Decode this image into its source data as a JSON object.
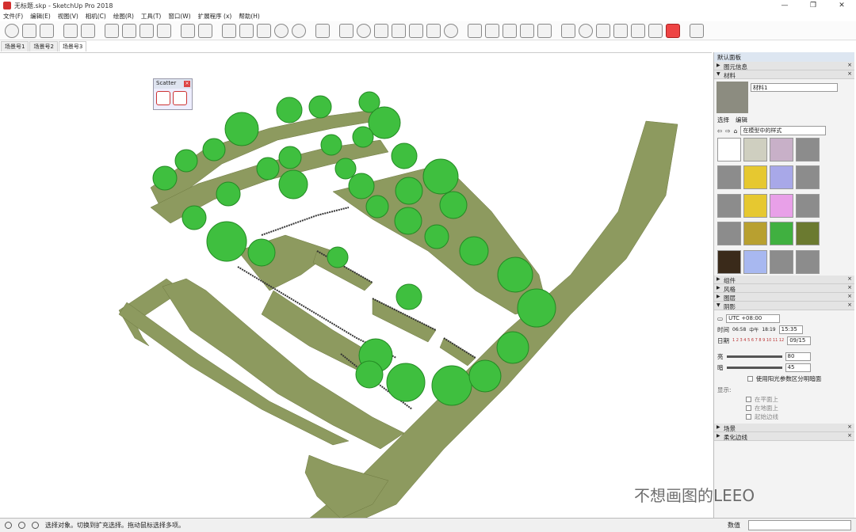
{
  "titlebar": {
    "title": "无标题.skp - SketchUp Pro 2018",
    "minimize": "—",
    "maximize": "❐",
    "close": "✕"
  },
  "menu": [
    "文件(F)",
    "编辑(E)",
    "视图(V)",
    "相机(C)",
    "绘图(R)",
    "工具(T)",
    "窗口(W)",
    "扩展程序 (x)",
    "帮助(H)"
  ],
  "scene_tabs": [
    "场景号1",
    "场景号2",
    "场景号3"
  ],
  "scatter": {
    "title": "Scatter"
  },
  "tray": {
    "title": "默认面板",
    "entity_info": "图元信息",
    "materials": "材料",
    "material_name": "材料1",
    "tab_select": "选择",
    "tab_edit": "编辑",
    "library": "在模型中的样式",
    "components": "组件",
    "styles": "风格",
    "layers": "图层",
    "shadows": "阴影",
    "timezone": "UTC +08:00",
    "time_label": "时间",
    "time_start": "06:58",
    "time_mid": "中午",
    "time_end": "18:19",
    "time_value": "15:35",
    "date_label": "日期",
    "months": "1 2 3 4 5 6 7 8 9 10 11 12",
    "date_value": "09/15",
    "light_label": "亮",
    "light_value": "80",
    "dark_label": "暗",
    "dark_value": "45",
    "use_sun": "使用阳光参数区分明暗面",
    "display_label": "显示:",
    "on_faces": "在平面上",
    "on_ground": "在地面上",
    "from_edges": "起始边线",
    "scenes": "场景",
    "soften": "柔化边线"
  },
  "status": {
    "hint": "选择对象。切换到扩充选择。拖动鼠标选择多项。",
    "measure_label": "数值"
  },
  "watermark": "不想画图的LEEO",
  "colors": {
    "ground": "#8d9a5f",
    "tree": "#3fbf3f",
    "tree_dark": "#238a23"
  }
}
